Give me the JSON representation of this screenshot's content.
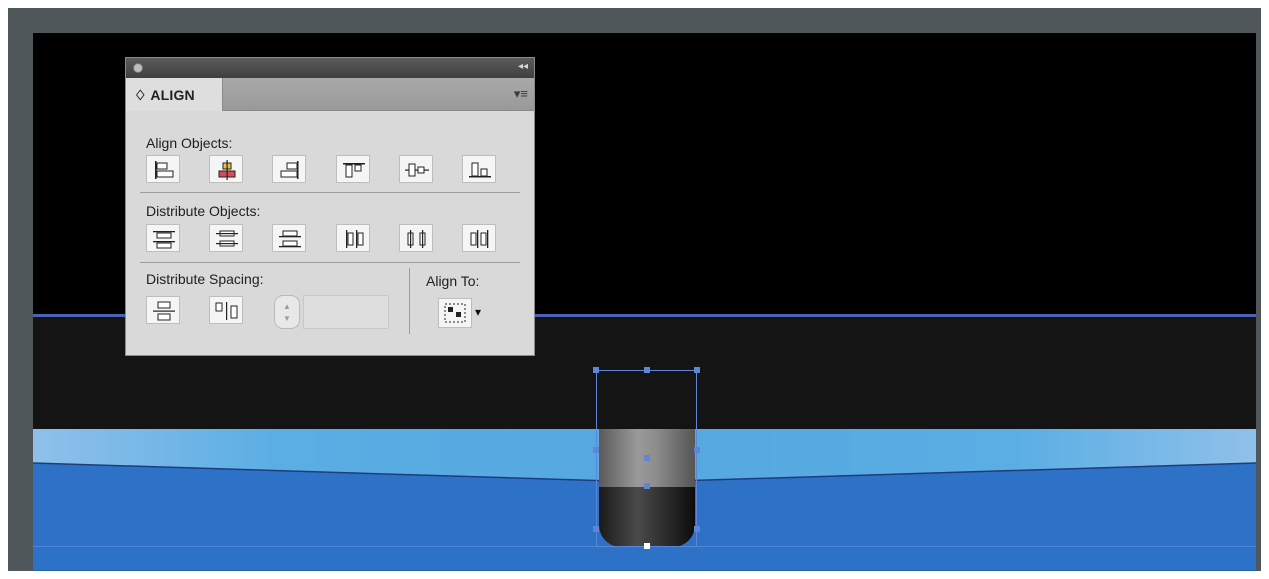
{
  "panel": {
    "tab_label": "♢ ALIGN",
    "collapse_icon": "◂◂",
    "menu_icon": "▾≡",
    "sections": {
      "align_objects": "Align Objects:",
      "distribute_objects": "Distribute Objects:",
      "distribute_spacing": "Distribute Spacing:",
      "align_to": "Align To:"
    },
    "align_objects_buttons": [
      "align-left-edges-icon",
      "align-horizontal-centers-icon",
      "align-right-edges-icon",
      "align-top-edges-icon",
      "align-vertical-centers-icon",
      "align-bottom-edges-icon"
    ],
    "distribute_objects_buttons": [
      "distribute-top-edges-icon",
      "distribute-vertical-centers-icon",
      "distribute-bottom-edges-icon",
      "distribute-left-edges-icon",
      "distribute-horizontal-centers-icon",
      "distribute-right-edges-icon"
    ],
    "distribute_spacing_buttons": [
      "distribute-vertical-space-icon",
      "distribute-horizontal-space-icon"
    ],
    "spacing_value": "",
    "align_to_arrow": "▾",
    "stepper_up": "▲",
    "stepper_down": "▼"
  },
  "colors": {
    "frame": "#50575b",
    "artboard": "#000000",
    "guide": "#4a63b8",
    "water_light": "#5aaee4",
    "water_dark": "#2d72c6",
    "selection": "#5f86d4",
    "accent_red": "#d94a5a",
    "accent_yellow": "#e8c24a"
  }
}
